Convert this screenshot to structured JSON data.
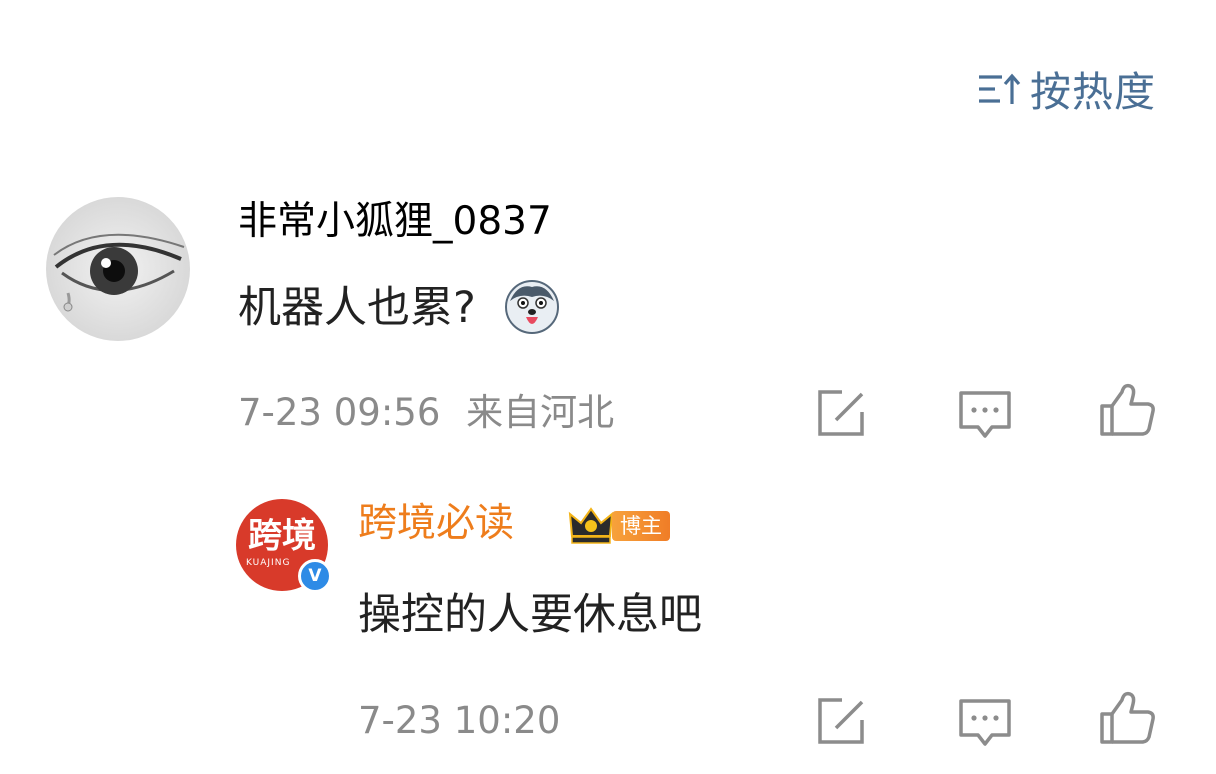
{
  "sort": {
    "label": "按热度",
    "icon": "sort-icon",
    "color": "#4a6f95"
  },
  "comments": [
    {
      "username": "非常小狐狸_0837",
      "username_color": "#555555",
      "text": "机器人也累?",
      "emoji": "husky-emoji",
      "date": "7-23 09:56",
      "location": "来自河北",
      "actions": [
        "share-icon",
        "comment-icon",
        "like-icon"
      ]
    },
    {
      "username": "跨境必读",
      "username_color": "#ee7d1c",
      "avatar_text": "跨境",
      "avatar_subtext": "KUAJING",
      "verified_badge": "V",
      "badge_label": "博主",
      "text": "操控的人要休息吧",
      "date": "7-23 10:20",
      "actions": [
        "share-icon",
        "comment-icon",
        "like-icon"
      ]
    }
  ]
}
